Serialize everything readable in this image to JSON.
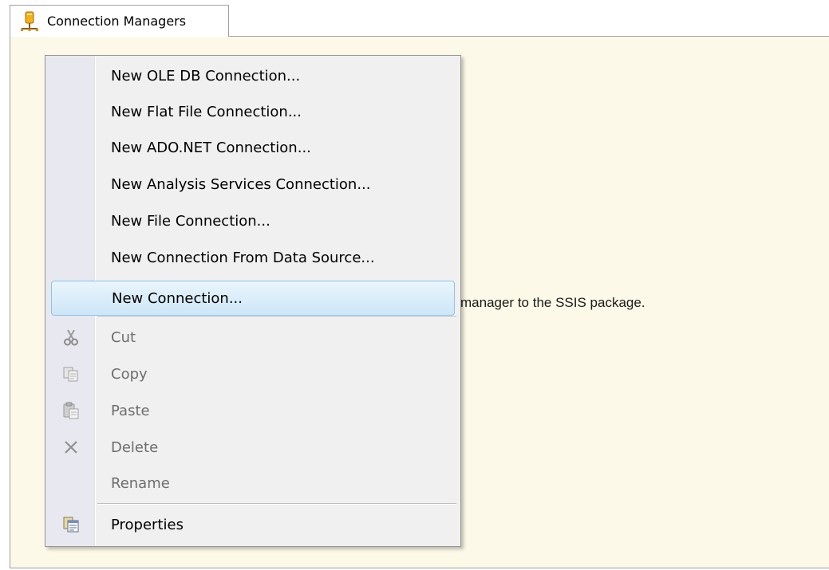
{
  "tab": {
    "label": "Connection Managers",
    "icon": "connection-manager-icon"
  },
  "pane": {
    "hint_text": "manager to the SSIS package."
  },
  "context_menu": {
    "items": [
      {
        "label": "New OLE DB Connection...",
        "enabled": true
      },
      {
        "label": "New Flat File Connection...",
        "enabled": true
      },
      {
        "label": "New ADO.NET Connection...",
        "enabled": true
      },
      {
        "label": "New Analysis Services Connection...",
        "enabled": true
      },
      {
        "label": "New File Connection...",
        "enabled": true
      },
      {
        "label": "New Connection From Data Source...",
        "enabled": true
      },
      {
        "label": "New Connection...",
        "enabled": true,
        "highlighted": true
      },
      {
        "label": "Cut",
        "enabled": false,
        "icon": "cut-icon"
      },
      {
        "label": "Copy",
        "enabled": false,
        "icon": "copy-icon"
      },
      {
        "label": "Paste",
        "enabled": false,
        "icon": "paste-icon"
      },
      {
        "label": "Delete",
        "enabled": false,
        "icon": "delete-icon"
      },
      {
        "label": "Rename",
        "enabled": false
      },
      {
        "label": "Properties",
        "enabled": true,
        "icon": "properties-icon"
      }
    ]
  },
  "colors": {
    "pane_background": "#fdf9e8",
    "menu_background": "#f0f0f0",
    "highlight_border": "#8ec1e6",
    "disabled_text": "#6d6d6d"
  }
}
